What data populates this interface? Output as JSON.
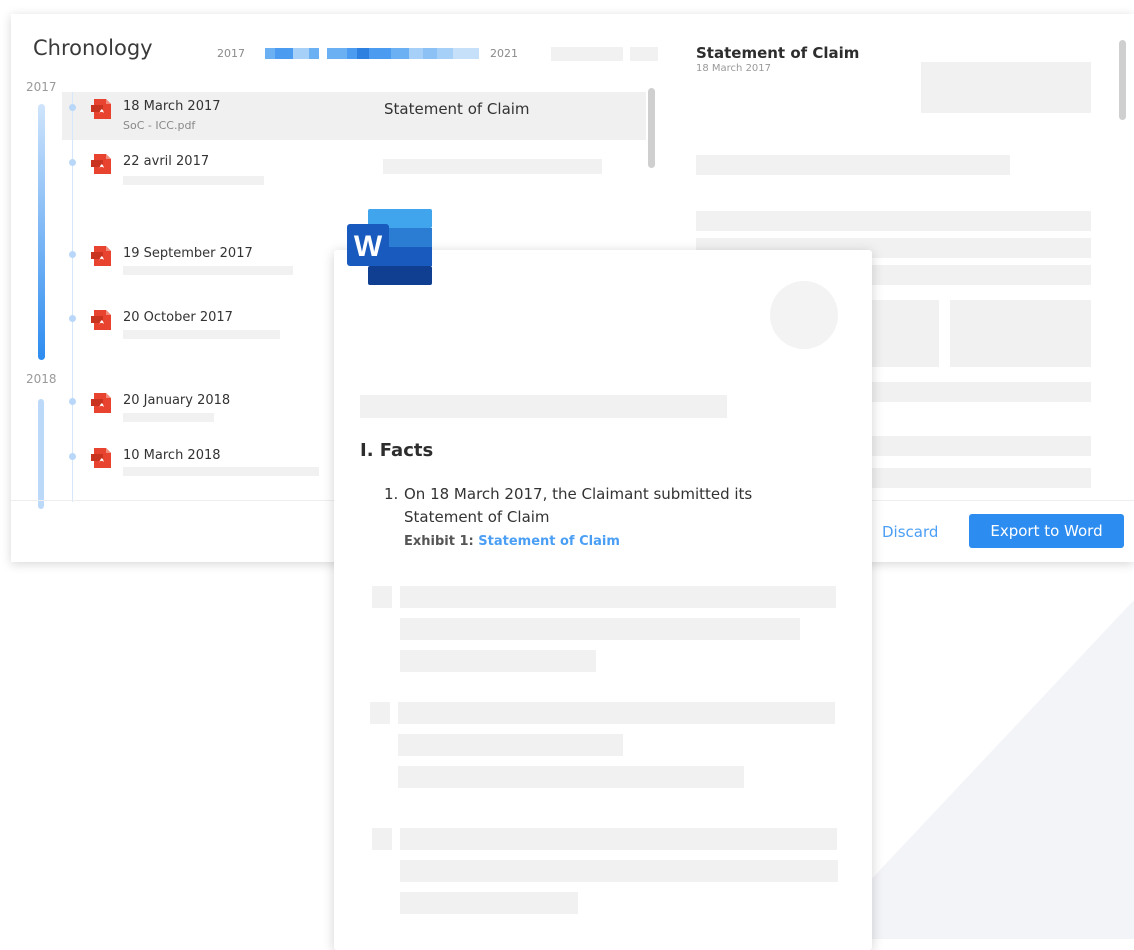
{
  "app": {
    "title": "Chronology"
  },
  "timeline_header": {
    "start_year": "2017",
    "end_year": "2021"
  },
  "timeline_years": [
    "2017",
    "2018"
  ],
  "entries": [
    {
      "date": "18 March 2017",
      "file": "SoC - ICC.pdf",
      "title": "Statement of Claim",
      "icon": "pdf-icon",
      "selected": true
    },
    {
      "date": "22 avril 2017",
      "file": "",
      "title": "",
      "icon": "pdf-icon",
      "selected": false
    },
    {
      "date": "19 September 2017",
      "file": "",
      "title": "",
      "icon": "pdf-icon",
      "selected": false
    },
    {
      "date": "20 October 2017",
      "file": "",
      "title": "",
      "icon": "pdf-icon",
      "selected": false
    },
    {
      "date": "20 January 2018",
      "file": "",
      "title": "",
      "icon": "pdf-icon",
      "selected": false
    },
    {
      "date": "10 March 2018",
      "file": "",
      "title": "",
      "icon": "pdf-icon",
      "selected": false
    }
  ],
  "preview": {
    "title": "Statement of Claim",
    "date": "18 March 2017"
  },
  "actions": {
    "discard": "Discard",
    "export": "Export to Word"
  },
  "word_doc": {
    "icon": "word-icon",
    "heading": "I. Facts",
    "item_number": "1.",
    "item_text": "On 18 March 2017, the Claimant submitted its Statement of Claim",
    "exhibit_label": "Exhibit 1:",
    "exhibit_link": "Statement of Claim"
  },
  "colors": {
    "accent": "#2d8cf0",
    "link": "#4a9ff5",
    "pdf_red": "#e8432e",
    "word_blue": "#185abd"
  }
}
